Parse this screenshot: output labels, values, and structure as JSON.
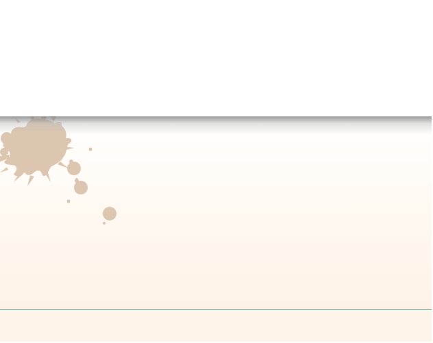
{
  "window": {
    "title": ""
  },
  "colors": {
    "background": "#ffffff",
    "panel_top": "#ffffff",
    "panel_bottom": "#fdf2e6",
    "splatter": "#dcc6b0",
    "divider": "#5a9f98",
    "footer": "#fdf4ea"
  },
  "icons": {
    "splatter": "ink-splatter-decoration"
  }
}
